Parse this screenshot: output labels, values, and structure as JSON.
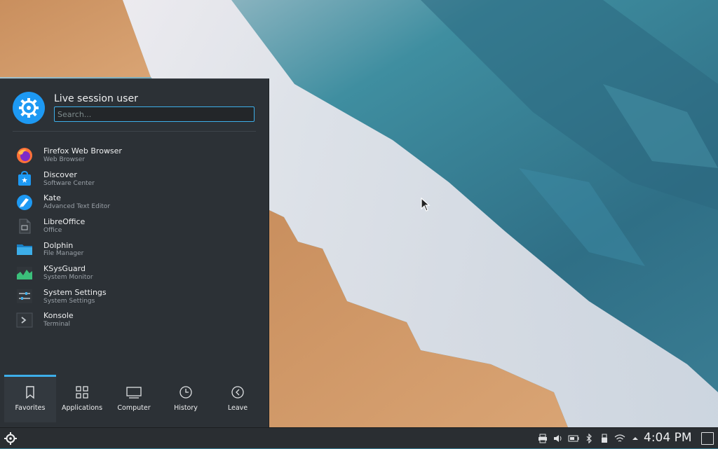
{
  "launcher": {
    "user_name": "Live session user",
    "search_placeholder": "Search...",
    "apps": [
      {
        "name": "Firefox Web Browser",
        "desc": "Web Browser",
        "icon": "firefox-icon"
      },
      {
        "name": "Discover",
        "desc": "Software Center",
        "icon": "discover-icon"
      },
      {
        "name": "Kate",
        "desc": "Advanced Text Editor",
        "icon": "kate-icon"
      },
      {
        "name": "LibreOffice",
        "desc": "Office",
        "icon": "libreoffice-icon"
      },
      {
        "name": "Dolphin",
        "desc": "File Manager",
        "icon": "folder-icon"
      },
      {
        "name": "KSysGuard",
        "desc": "System Monitor",
        "icon": "system-monitor-icon"
      },
      {
        "name": "System Settings",
        "desc": "System Settings",
        "icon": "settings-icon"
      },
      {
        "name": "Konsole",
        "desc": "Terminal",
        "icon": "terminal-icon"
      }
    ],
    "tabs": [
      {
        "label": "Favorites",
        "icon": "bookmark-icon",
        "active": true
      },
      {
        "label": "Applications",
        "icon": "grid-icon",
        "active": false
      },
      {
        "label": "Computer",
        "icon": "monitor-icon",
        "active": false
      },
      {
        "label": "History",
        "icon": "clock-icon",
        "active": false
      },
      {
        "label": "Leave",
        "icon": "leave-icon",
        "active": false
      }
    ]
  },
  "panel": {
    "clock": "4:04 PM",
    "tray_icons": [
      "printer-icon",
      "volume-icon",
      "battery-icon",
      "bluetooth-icon",
      "usb-icon",
      "wifi-icon",
      "expand-tray-icon"
    ]
  },
  "colors": {
    "accent": "#3daee9",
    "panel_bg": "#2a2e32",
    "launcher_bg": "#2c3136"
  }
}
